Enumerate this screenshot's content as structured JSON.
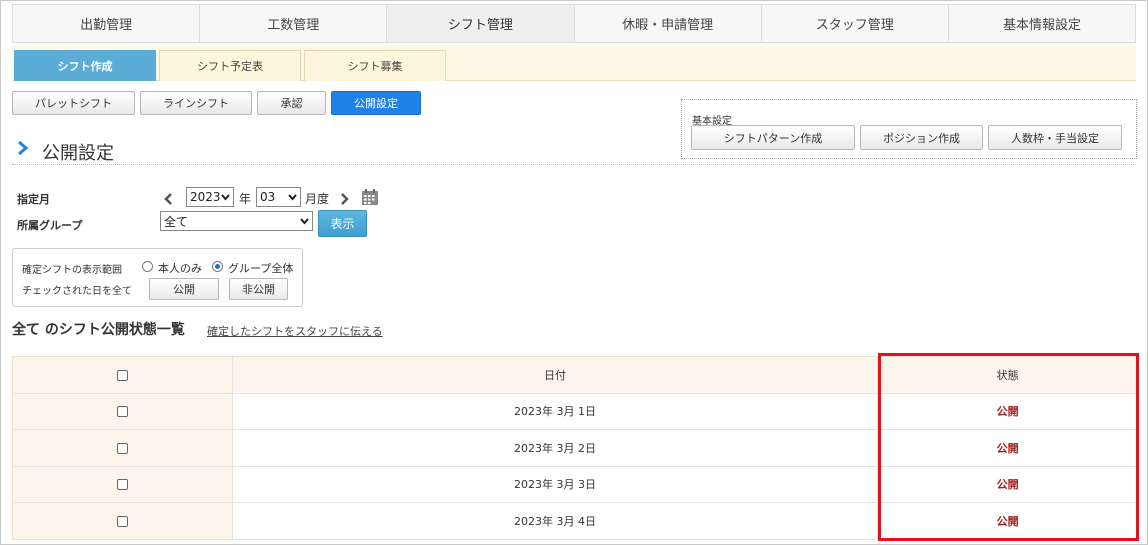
{
  "main_nav": [
    "出勤管理",
    "工数管理",
    "シフト管理",
    "休暇・申請管理",
    "スタッフ管理",
    "基本情報設定"
  ],
  "sub_tabs": [
    "シフト作成",
    "シフト予定表",
    "シフト募集"
  ],
  "toolbar": {
    "pallet": "パレットシフト",
    "line": "ラインシフト",
    "approve": "承認",
    "publish_setting": "公開設定"
  },
  "settings": {
    "label": "基本設定",
    "pattern": "シフトパターン作成",
    "position": "ポジション作成",
    "headcount": "人数枠・手当設定"
  },
  "page_title": "公開設定",
  "form": {
    "month_label": "指定月",
    "year_value": "2023",
    "year_suffix": "年",
    "month_value": "03",
    "month_suffix": "月度",
    "group_label": "所属グループ",
    "group_value": "全て",
    "show_button": "表示"
  },
  "range": {
    "label": "確定シフトの表示範囲",
    "opt_self": "本人のみ",
    "opt_group": "グループ全体",
    "selected": "グループ全体",
    "checked_label": "チェックされた日を全て",
    "publish": "公開",
    "unpublish": "非公開"
  },
  "list": {
    "title": "全て のシフト公開状態一覧",
    "link": "確定したシフトをスタッフに伝える",
    "headers": {
      "date": "日付",
      "status": "状態"
    },
    "rows": [
      {
        "date": "2023年 3月 1日",
        "status": "公開"
      },
      {
        "date": "2023年 3月 2日",
        "status": "公開"
      },
      {
        "date": "2023年 3月 3日",
        "status": "公開"
      },
      {
        "date": "2023年 3月 4日",
        "status": "公開"
      }
    ]
  },
  "colors": {
    "accent": "#1f82ea",
    "sub_tab_active": "#5bacd6",
    "status": "#a01c1c",
    "highlight": "#e0141e"
  }
}
